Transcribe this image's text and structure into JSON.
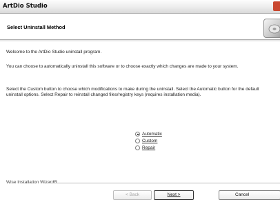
{
  "window": {
    "title": "ArtDio Studio"
  },
  "header": {
    "heading": "Select Uninstall Method",
    "logo_icon": "installer-disc-icon"
  },
  "body": {
    "welcome": "Welcome to the ArtDio Studio uninstall program.",
    "choose": "You can choose to automatically uninstall this software or to choose exactly which changes are made to your system.",
    "select": "Select the Custom button to choose which modifications to make during the uninstall. Select the Automatic button for the default uninstall options. Select Repair to reinstall changed files/registry keys (requires installation media)."
  },
  "options": [
    {
      "label": "Automatic",
      "checked": true
    },
    {
      "label": "Custom",
      "checked": false
    },
    {
      "label": "Repair",
      "checked": false
    }
  ],
  "footer": {
    "wizard_label": "Wise Installation WizardR",
    "back_label": "< Back",
    "next_label": "Next >",
    "cancel_label": "Cancel"
  }
}
